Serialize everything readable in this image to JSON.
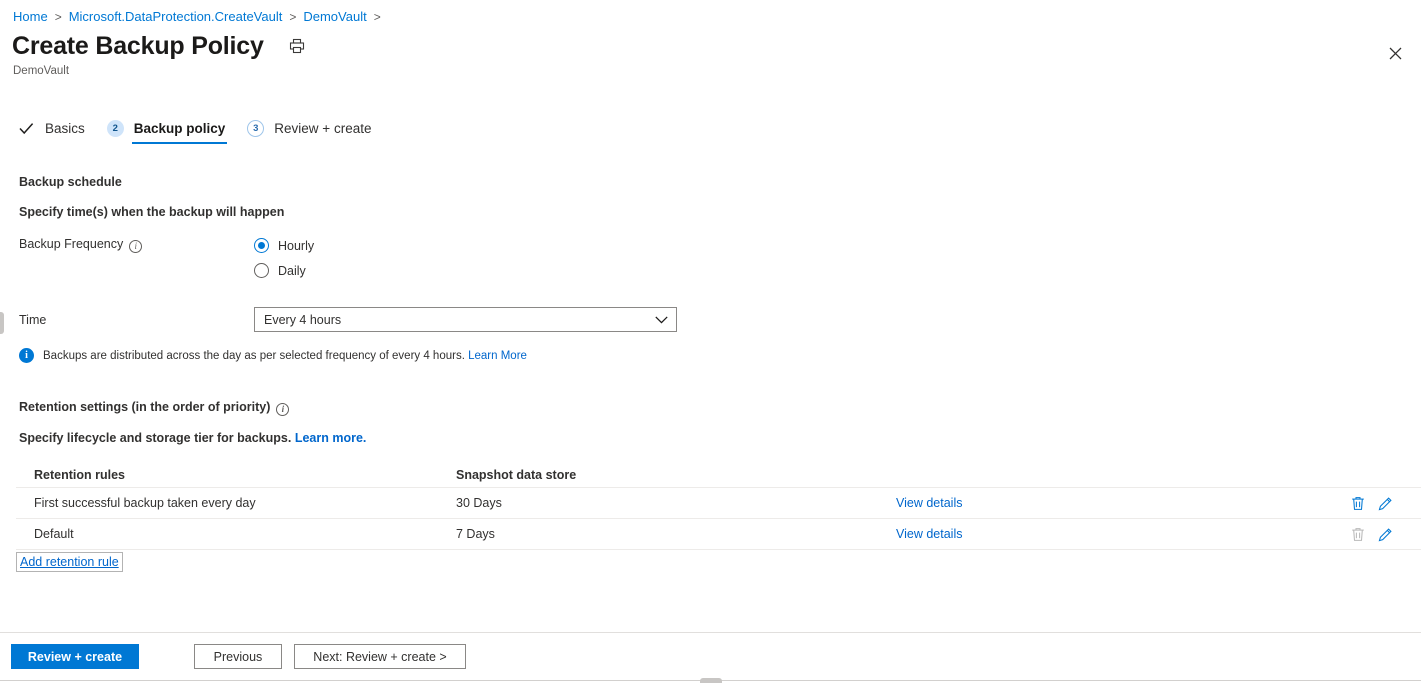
{
  "breadcrumb": {
    "items": [
      {
        "label": "Home"
      },
      {
        "label": "Microsoft.DataProtection.CreateVault"
      },
      {
        "label": "DemoVault"
      }
    ],
    "separator": ">"
  },
  "header": {
    "title": "Create Backup Policy",
    "subtitle": "DemoVault",
    "print_icon": "printer-icon",
    "close_icon": "close-icon"
  },
  "tabs": [
    {
      "marker": "✓",
      "marker_type": "check",
      "label": "Basics",
      "active": false
    },
    {
      "marker": "2",
      "marker_type": "filled",
      "label": "Backup policy",
      "active": true
    },
    {
      "marker": "3",
      "marker_type": "outline",
      "label": "Review + create",
      "active": false
    }
  ],
  "schedule": {
    "heading": "Backup schedule",
    "subtext": "Specify time(s) when the backup will happen",
    "frequency_label": "Backup Frequency",
    "frequency_info_icon": "info-icon",
    "options": [
      {
        "label": "Hourly",
        "checked": true
      },
      {
        "label": "Daily",
        "checked": false
      }
    ],
    "time_label": "Time",
    "time_value": "Every 4 hours",
    "time_chevron_icon": "chevron-down-icon",
    "info_banner": {
      "icon": "info-filled-icon",
      "badge_glyph": "i",
      "text": "Backups are distributed across the day as per selected frequency of every 4 hours.",
      "link": "Learn More"
    }
  },
  "retention": {
    "heading": "Retention settings (in the order of priority)",
    "heading_info_icon": "info-icon",
    "subtext": "Specify lifecycle and storage tier for backups.",
    "subtext_link": "Learn more.",
    "columns": [
      "Retention rules",
      "Snapshot data store"
    ],
    "rows": [
      {
        "rule": "First successful backup taken every day",
        "store": "30 Days",
        "details_link": "View details",
        "delete_icon": "trash-icon",
        "delete_enabled": true,
        "edit_icon": "pencil-icon"
      },
      {
        "rule": "Default",
        "store": "7 Days",
        "details_link": "View details",
        "delete_icon": "trash-icon",
        "delete_enabled": false,
        "edit_icon": "pencil-icon"
      }
    ],
    "add_rule_label": "Add retention rule"
  },
  "footer": {
    "primary": "Review + create",
    "previous": "Previous",
    "next": "Next: Review + create >"
  },
  "colors": {
    "accent": "#0078d4",
    "link": "#0066cc",
    "text": "#323130",
    "border": "#8a8886",
    "divider": "#edebe9"
  }
}
